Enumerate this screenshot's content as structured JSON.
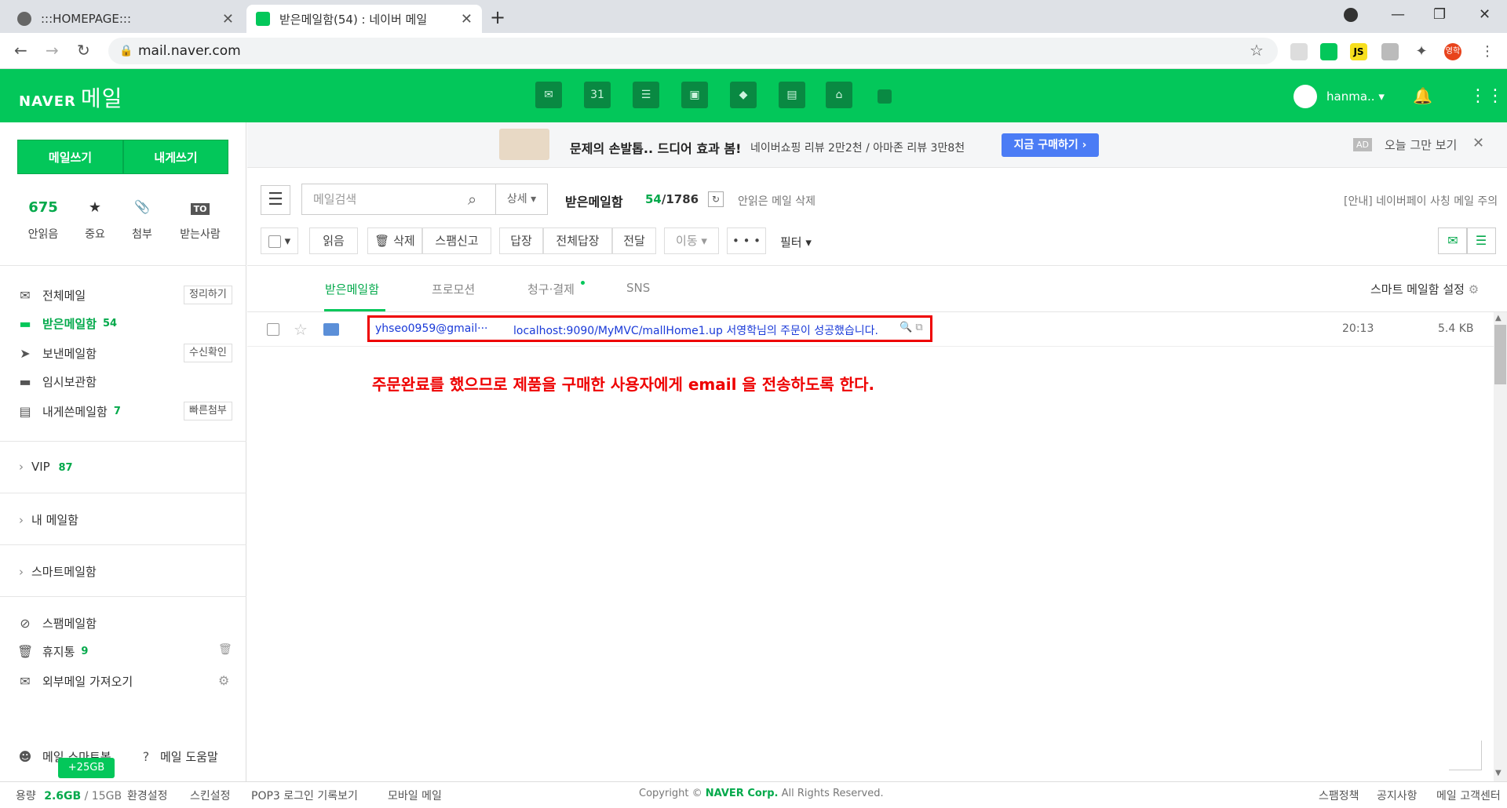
{
  "browser": {
    "tabs": [
      {
        "title": ":::HOMEPAGE:::",
        "active": false
      },
      {
        "title": "받은메일함(54) : 네이버 메일",
        "active": true
      }
    ],
    "url": "mail.naver.com",
    "profile_badge": "영학",
    "ext_js": "JS"
  },
  "header": {
    "logo_brand": "NAVER",
    "logo_service": "메일",
    "service_icons": [
      "mail-icon",
      "calendar-icon",
      "list-icon",
      "contacts-icon",
      "box-icon",
      "memo-icon",
      "home-icon",
      "more-icon"
    ],
    "calendar_day": "31",
    "user_name": "hanma..",
    "accent_color": "#03c75a"
  },
  "sidebar": {
    "compose_label": "메일쓰기",
    "self_compose_label": "내게쓰기",
    "quick": [
      {
        "value": "675",
        "label": "안읽음"
      },
      {
        "value": "★",
        "label": "중요"
      },
      {
        "value": "📎",
        "label": "첨부"
      },
      {
        "value": "TO",
        "label": "받는사람"
      }
    ],
    "folders": [
      {
        "label": "전체메일",
        "count": "",
        "button": "정리하기"
      },
      {
        "label": "받은메일함",
        "count": "54",
        "button": ""
      },
      {
        "label": "보낸메일함",
        "count": "",
        "button": "수신확인"
      },
      {
        "label": "임시보관함",
        "count": "",
        "button": ""
      },
      {
        "label": "내게쓴메일함",
        "count": "7",
        "button": "빠른첨부"
      }
    ],
    "groups": [
      {
        "label": "VIP",
        "count": "87"
      },
      {
        "label": "내 메일함",
        "count": ""
      },
      {
        "label": "스마트메일함",
        "count": ""
      }
    ],
    "bottom_folders": [
      {
        "label": "스팸메일함",
        "count": ""
      },
      {
        "label": "휴지통",
        "count": "9"
      },
      {
        "label": "외부메일 가져오기",
        "count": ""
      }
    ],
    "smartbot": "메일 스마트봇",
    "help": "메일 도움말",
    "plus_badge": "+25GB"
  },
  "footer": {
    "storage_label": "용량",
    "storage_used": "2.6GB",
    "storage_total": "/ 15GB",
    "links": [
      "환경설정",
      "스킨설정",
      "POP3 로그인 기록보기",
      "모바일 메일"
    ],
    "copyright_pre": "Copyright ©",
    "copyright_brand": "NAVER Corp.",
    "copyright_post": "All Rights Reserved.",
    "right_links": [
      "스팸정책",
      "공지사항",
      "메일 고객센터"
    ]
  },
  "ad": {
    "title": "문제의 손발톱.. 드디어 효과 봄!",
    "subtitle": "네이버쇼핑 리뷰 2만2천 / 아마존 리뷰 3만8천",
    "button": "지금 구매하기 ›",
    "tag": "AD",
    "hide": "오늘 그만 보기"
  },
  "toolbar": {
    "search_placeholder": "메일검색",
    "detail": "상세 ▾",
    "box_name": "받은메일함",
    "unread": "54",
    "total": "/1786",
    "delete_unread": "안읽은 메일 삭제",
    "notice": "[안내] 네이버페이 사칭 메일 주의",
    "buttons": [
      "읽음",
      "🗑 삭제",
      "스팸신고",
      "답장",
      "전체답장",
      "전달",
      "이동 ▾",
      "• • •"
    ],
    "filter": "필터 ▾"
  },
  "mail_tabs": {
    "tabs": [
      "받은메일함",
      "프로모션",
      "청구·결제",
      "SNS"
    ],
    "smart_setting": "스마트 메일함 설정"
  },
  "mail": {
    "sender": "yhseo0959@gmail···",
    "subject": "localhost:9090/MyMVC/mallHome1.up 서영학님의 주문이 성공했습니다.",
    "time": "20:13",
    "size": "5.4 KB"
  },
  "annotation": "주문완료를 했으므로 제품을 구매한 사용자에게 email 을 전송하도록 한다."
}
